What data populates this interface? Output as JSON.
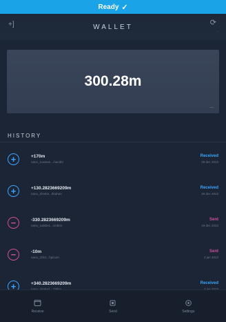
{
  "status_bar": {
    "text": "Ready",
    "check": "✓"
  },
  "header": {
    "title": "WALLET",
    "left_icon": "+]",
    "right_icon": "⟳",
    "node_text": "..."
  },
  "balance": {
    "amount": "300.28m",
    "mini": "..."
  },
  "history": {
    "label": "HISTORY",
    "items": [
      {
        "direction": "in",
        "amount": "+170m",
        "address": "nano_1uwnan....hao3kt",
        "status": "Received",
        "date": "29 dec 2023"
      },
      {
        "direction": "in",
        "amount": "+130.2823669209m",
        "address": "nano_1hmbn...ifeahon",
        "status": "Received",
        "date": "29 dec 2023"
      },
      {
        "direction": "out",
        "amount": "-330.2823669209m",
        "address": "nano_1aikbx1...cmbctr",
        "status": "Sent",
        "date": "19 dec 2023"
      },
      {
        "direction": "out",
        "amount": "-10m",
        "address": "nano_1hb1...hpicum",
        "status": "Sent",
        "date": "3 jan 2023"
      },
      {
        "direction": "in",
        "amount": "+340.2823669209m",
        "address": "nano_1kaknd....73kim",
        "status": "Received",
        "date": "3 jan 2023"
      }
    ]
  },
  "tabs": [
    {
      "label": "Receive",
      "icon": "receive-icon"
    },
    {
      "label": "Send",
      "icon": "send-icon"
    },
    {
      "label": "Settings",
      "icon": "settings-icon"
    }
  ],
  "colors": {
    "accent": "#1ba3e8",
    "received": "#3aa4ff",
    "sent": "#d04f9c",
    "background": "#1c2535"
  }
}
